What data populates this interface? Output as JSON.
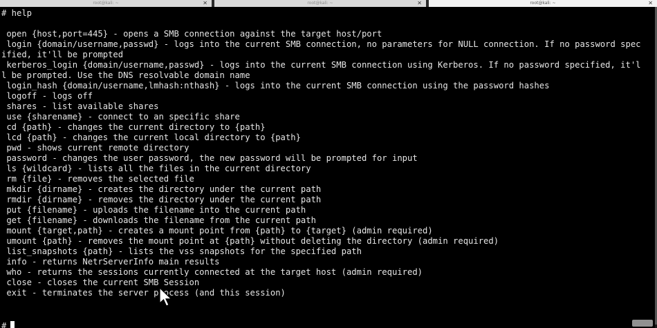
{
  "tabs": [
    {
      "title": "root@kali: ~",
      "active": false
    },
    {
      "title": "root@kali: ~",
      "active": false
    },
    {
      "title": "root@kali: ~",
      "active": true
    }
  ],
  "terminal": {
    "lines": [
      "# help",
      "",
      " open {host,port=445} - opens a SMB connection against the target host/port",
      " login {domain/username,passwd} - logs into the current SMB connection, no parameters for NULL connection. If no password spec",
      "ified, it'll be prompted",
      " kerberos_login {domain/username,passwd} - logs into the current SMB connection using Kerberos. If no password specified, it'l",
      "l be prompted. Use the DNS resolvable domain name",
      " login_hash {domain/username,lmhash:nthash} - logs into the current SMB connection using the password hashes",
      " logoff - logs off",
      " shares - list available shares",
      " use {sharename} - connect to an specific share",
      " cd {path} - changes the current directory to {path}",
      " lcd {path} - changes the current local directory to {path}",
      " pwd - shows current remote directory",
      " password - changes the user password, the new password will be prompted for input",
      " ls {wildcard} - lists all the files in the current directory",
      " rm {file} - removes the selected file",
      " mkdir {dirname} - creates the directory under the current path",
      " rmdir {dirname} - removes the directory under the current path",
      " put {filename} - uploads the filename into the current path",
      " get {filename} - downloads the filename from the current path",
      " mount {target,path} - creates a mount point from {path} to {target} (admin required)",
      " umount {path} - removes the mount point at {path} without deleting the directory (admin required)",
      " list_snapshots {path} - lists the vss snapshots for the specified path",
      " info - returns NetrServerInfo main results",
      " who - returns the sessions currently connected at the target host (admin required)",
      " close - closes the current SMB Session",
      " exit - terminates the server process (and this session)",
      "",
      "",
      ""
    ],
    "prompt": "#"
  },
  "icons": {
    "tab_close": "close-icon",
    "mouse": "mouse-pointer-icon",
    "text_cursor": "terminal-cursor"
  },
  "colors": {
    "background": "#000000",
    "foreground": "#e6e6e6",
    "tab_inactive": "#d9d9d9",
    "tab_active": "#f2f2f2"
  }
}
